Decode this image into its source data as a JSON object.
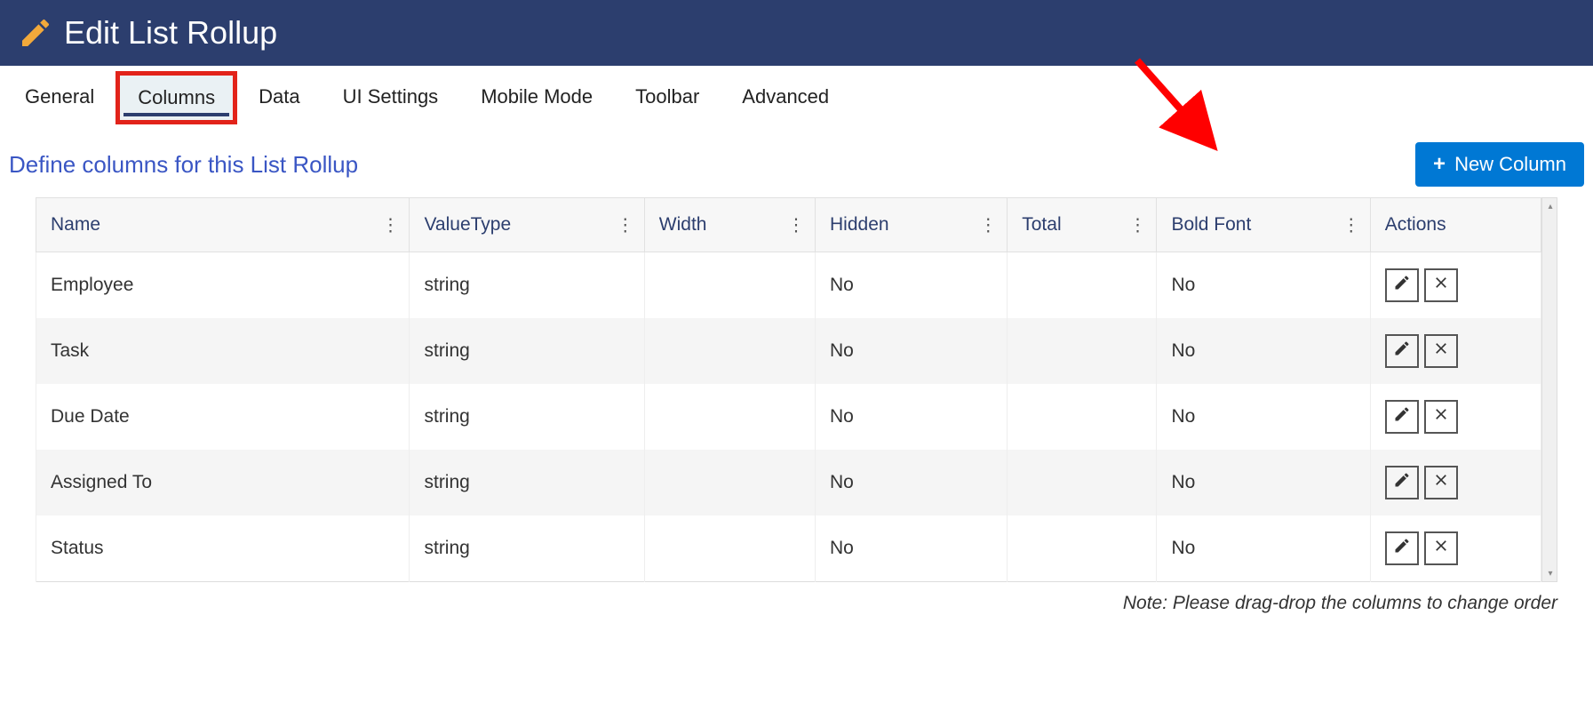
{
  "header": {
    "title": "Edit List Rollup"
  },
  "tabs": [
    {
      "label": "General",
      "active": false
    },
    {
      "label": "Columns",
      "active": true
    },
    {
      "label": "Data",
      "active": false
    },
    {
      "label": "UI Settings",
      "active": false
    },
    {
      "label": "Mobile Mode",
      "active": false
    },
    {
      "label": "Toolbar",
      "active": false
    },
    {
      "label": "Advanced",
      "active": false
    }
  ],
  "subheader": "Define columns for this List Rollup",
  "newColumnLabel": "New Column",
  "columns": {
    "headers": [
      "Name",
      "ValueType",
      "Width",
      "Hidden",
      "Total",
      "Bold Font",
      "Actions"
    ],
    "rows": [
      {
        "name": "Employee",
        "valueType": "string",
        "width": "",
        "hidden": "No",
        "total": "",
        "boldFont": "No"
      },
      {
        "name": "Task",
        "valueType": "string",
        "width": "",
        "hidden": "No",
        "total": "",
        "boldFont": "No"
      },
      {
        "name": "Due Date",
        "valueType": "string",
        "width": "",
        "hidden": "No",
        "total": "",
        "boldFont": "No"
      },
      {
        "name": "Assigned To",
        "valueType": "string",
        "width": "",
        "hidden": "No",
        "total": "",
        "boldFont": "No"
      },
      {
        "name": "Status",
        "valueType": "string",
        "width": "",
        "hidden": "No",
        "total": "",
        "boldFont": "No"
      }
    ]
  },
  "note": "Note: Please drag-drop the columns to change order"
}
